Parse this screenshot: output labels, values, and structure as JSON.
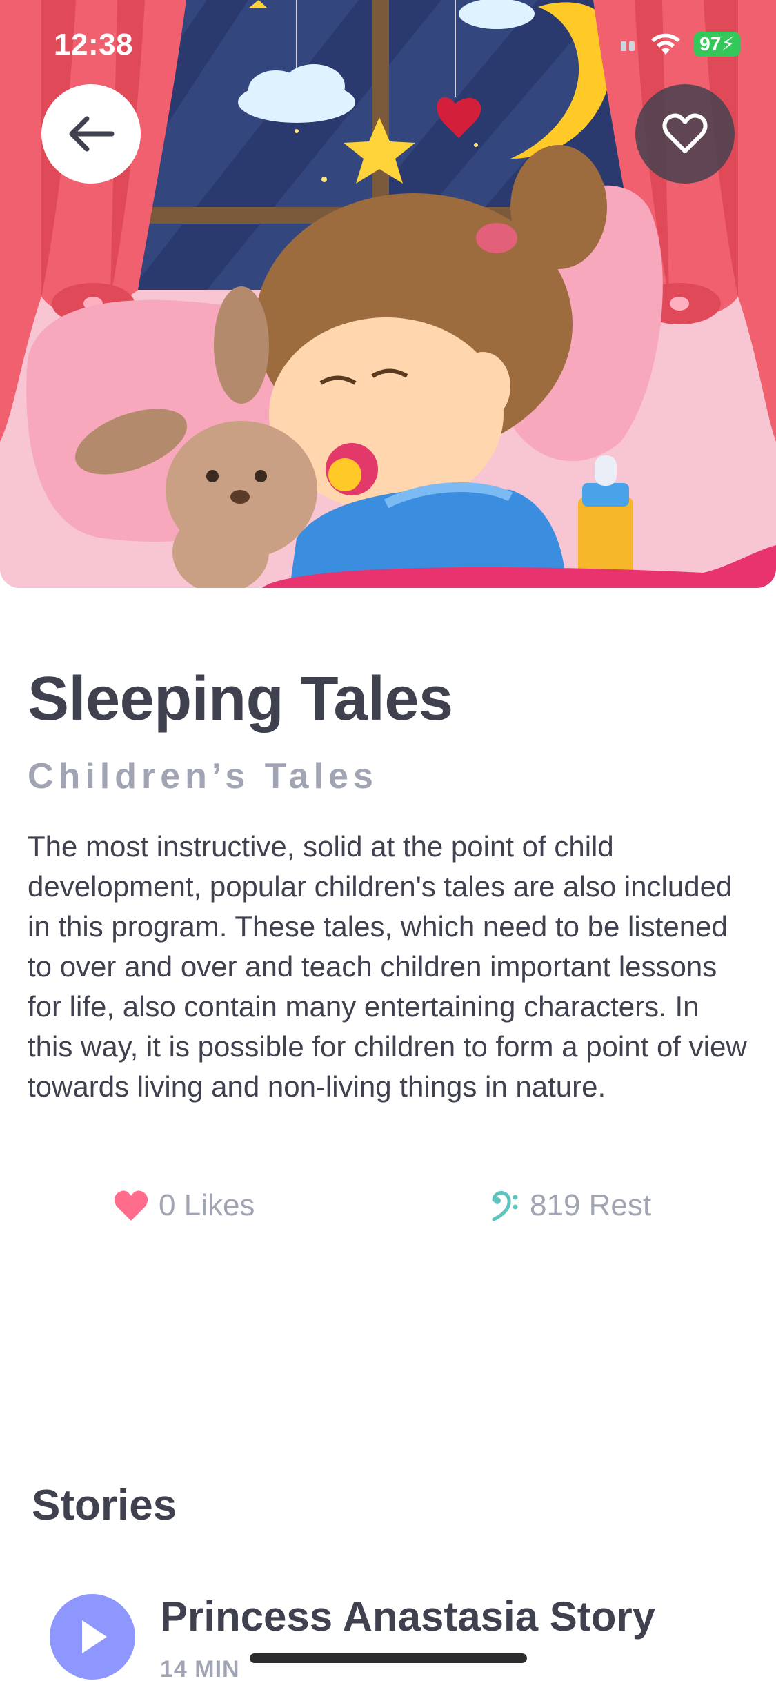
{
  "status_bar": {
    "time": "12:38",
    "battery": "97"
  },
  "hero": {
    "image_alt": "Sleeping child illustration"
  },
  "header": {
    "back_icon": "arrow-left-icon",
    "favorite_icon": "heart-outline-icon"
  },
  "detail": {
    "title": "Sleeping Tales",
    "subtitle": "Children’s Tales",
    "description": "The most instructive, solid at the point of child development, popular children's tales are also included in this program. These tales, which need to be listened to over and over and teach children important lessons for life, also contain many entertaining characters. In this way, it is possible for children to form a point of view towards living and non-living things in nature."
  },
  "stats": {
    "likes_label": "0 Likes",
    "rest_label": "819 Rest"
  },
  "stories": {
    "heading": "Stories",
    "items": [
      {
        "title": "Princess Anastasia Story",
        "duration": "14 MIN"
      }
    ]
  },
  "colors": {
    "accent": "#8e97fd",
    "text_primary": "#3f414e",
    "text_secondary": "#a1a4b2",
    "like": "#ff6b8b",
    "rest": "#5ec4c0"
  }
}
